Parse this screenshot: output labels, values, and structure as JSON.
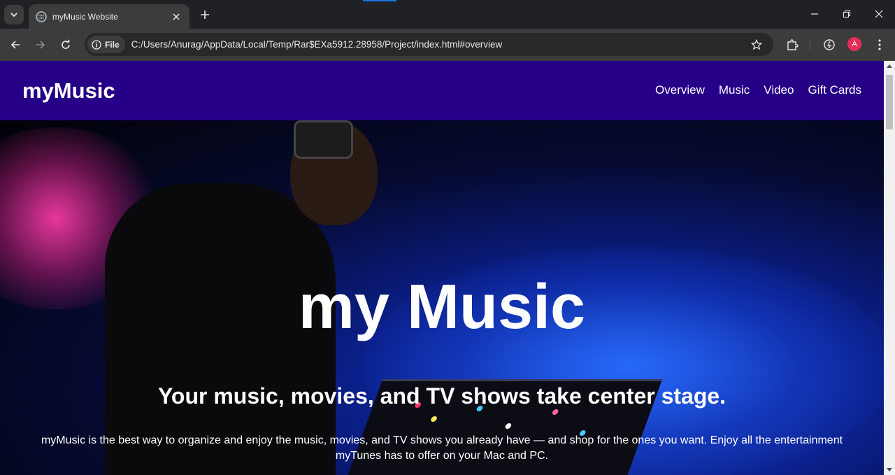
{
  "browser": {
    "tab": {
      "title": "myMusic Website"
    },
    "address": {
      "chip_label": "File",
      "url": "C:/Users/Anurag/AppData/Local/Temp/Rar$EXa5912.28958/Project/index.html#overview"
    },
    "profile_initial": "A"
  },
  "site": {
    "logo": "myMusic",
    "nav": [
      "Overview",
      "Music",
      "Video",
      "Gift Cards"
    ],
    "hero": {
      "title": "my Music",
      "subtitle": "Your music, movies, and TV shows take center stage.",
      "description": "myMusic is the best way to organize and enjoy the music, movies, and TV shows you already have — and shop for the ones you want. Enjoy all the entertainment myTunes has to offer on your Mac and PC."
    },
    "colors": {
      "header_bg": "#260087",
      "text": "#ffffff"
    }
  }
}
